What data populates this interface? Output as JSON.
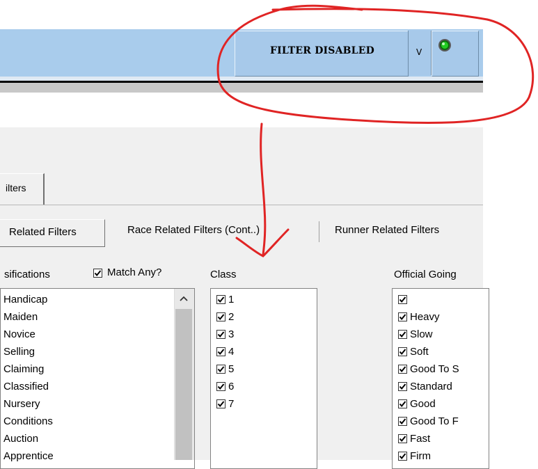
{
  "topbar": {
    "filter_status": "FILTER DISABLED",
    "toggle_label": "V",
    "led_color": "#22cc22"
  },
  "main": {
    "outer_tab_label": "ilters",
    "subtabs": [
      {
        "label": "Related Filters",
        "selected": true
      },
      {
        "label": "Race Related Filters (Cont..)",
        "selected": false
      },
      {
        "label": "Runner Related Filters",
        "selected": false
      }
    ],
    "classifications": {
      "label": "sifications",
      "match_any_label": "Match Any?",
      "match_any_checked": true,
      "items": [
        "Handicap",
        "Maiden",
        "Novice",
        "Selling",
        "Claiming",
        "Classified",
        "Nursery",
        "Conditions",
        "Auction",
        "Apprentice"
      ]
    },
    "class_filter": {
      "label": "Class",
      "items": [
        "1",
        "2",
        "3",
        "4",
        "5",
        "6",
        "7"
      ],
      "all_checked": true
    },
    "official_going": {
      "label": "Official Going",
      "items": [
        "",
        "Heavy",
        "Slow",
        "Soft",
        "Good To S",
        "Standard",
        "Good",
        "Good To F",
        "Fast",
        "Firm"
      ],
      "all_checked": true
    }
  },
  "colors": {
    "annotation": "#e02424",
    "topbar": "#a9ccec",
    "panel": "#f0f0f0"
  }
}
